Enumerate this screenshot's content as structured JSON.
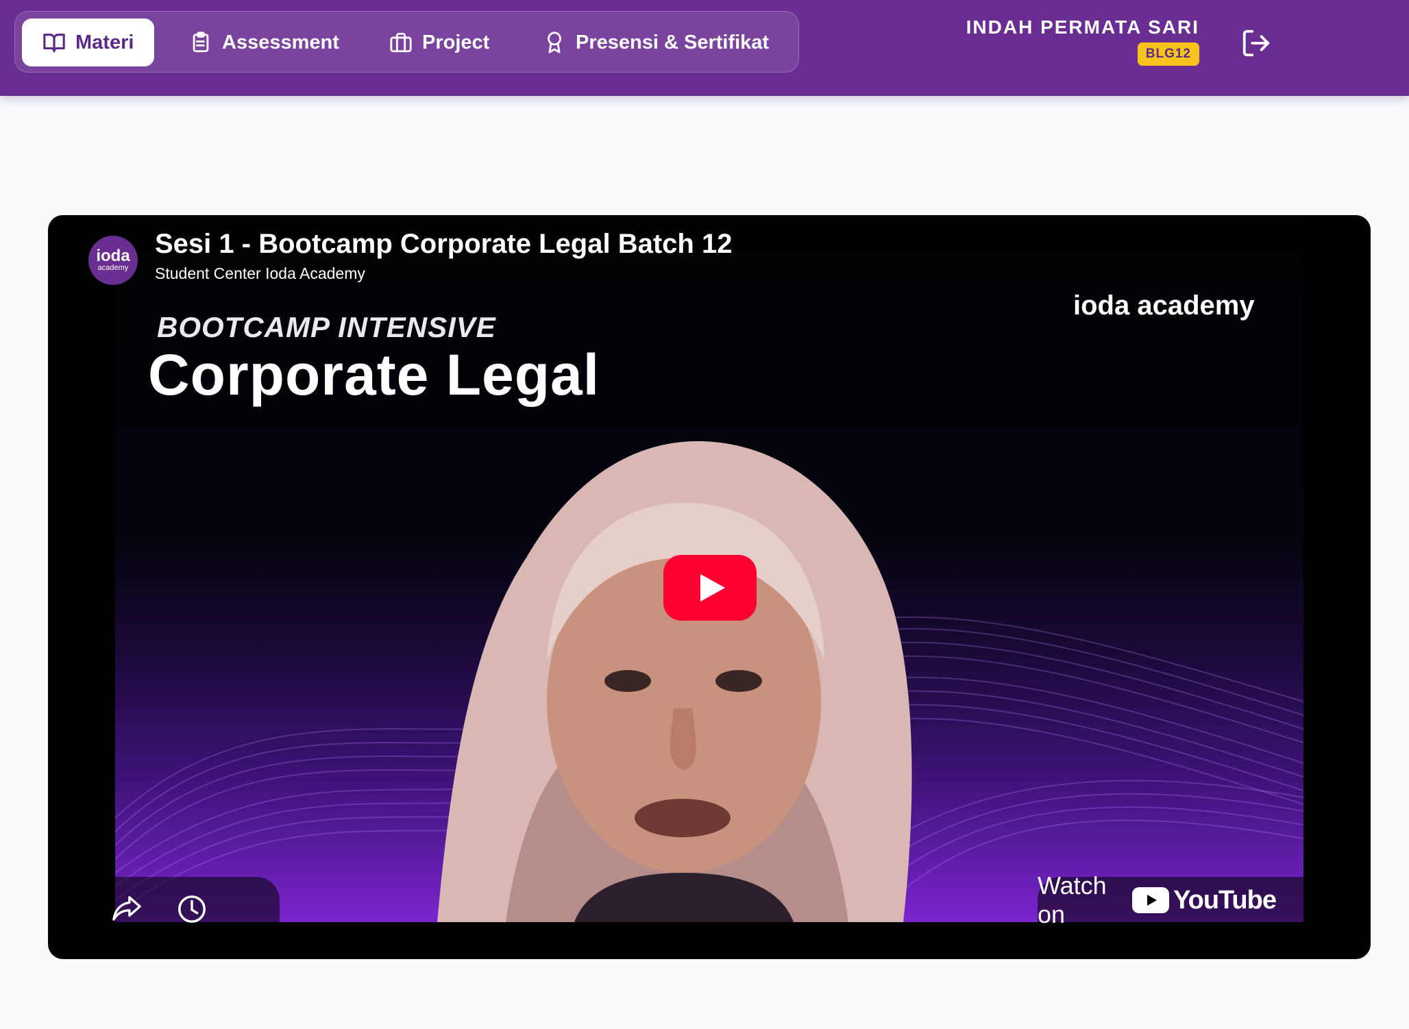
{
  "nav": {
    "items": [
      {
        "label": "Materi",
        "icon": "book-open-icon",
        "active": true
      },
      {
        "label": "Assessment",
        "icon": "clipboard-list-icon",
        "active": false
      },
      {
        "label": "Project",
        "icon": "briefcase-icon",
        "active": false
      },
      {
        "label": "Presensi & Sertifikat",
        "icon": "award-ribbon-icon",
        "active": false
      }
    ]
  },
  "user": {
    "name": "INDAH PERMATA SARI",
    "badge": "BLG12",
    "logout_icon": "logout-icon"
  },
  "video": {
    "title": "Sesi 1 - Bootcamp Corporate Legal Batch 12",
    "channel": "Student Center Ioda Academy",
    "avatar_line1": "ioda",
    "avatar_line2": "academy",
    "thumbnail_subtitle": "BOOTCAMP INTENSIVE",
    "thumbnail_title": "Corporate Legal",
    "thumbnail_logo": "ioda academy",
    "watch_on": "Watch on",
    "youtube": "YouTube"
  },
  "colors": {
    "header": "#6a2e93",
    "badge": "#f7c21c",
    "youtube_red": "#ff0033"
  }
}
